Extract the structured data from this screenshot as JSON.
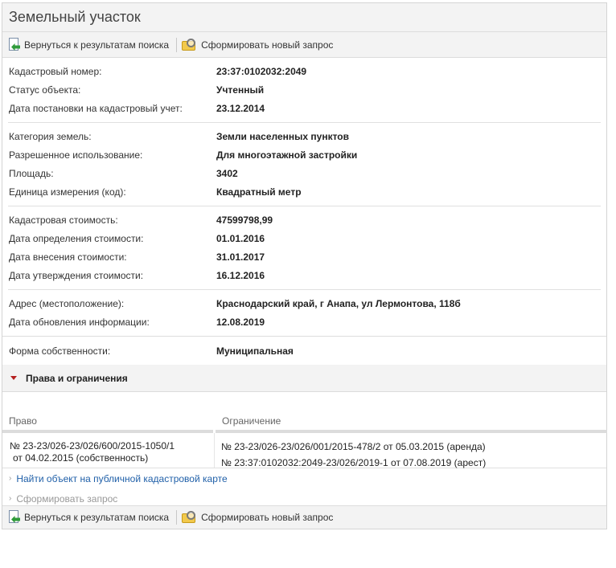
{
  "title": "Земельный участок",
  "toolbar": {
    "back_label": "Вернуться к результатам поиска",
    "new_query_label": "Сформировать новый запрос"
  },
  "groups": [
    [
      {
        "key": "Кадастровый номер:",
        "value": "23:37:0102032:2049"
      },
      {
        "key": "Статус объекта:",
        "value": "Учтенный"
      },
      {
        "key": "Дата постановки на кадастровый учет:",
        "value": "23.12.2014"
      }
    ],
    [
      {
        "key": "Категория земель:",
        "value": "Земли населенных пунктов"
      },
      {
        "key": "Разрешенное использование:",
        "value": "Для многоэтажной застройки"
      },
      {
        "key": "Площадь:",
        "value": "3402"
      },
      {
        "key": "Единица измерения (код):",
        "value": "Квадратный метр"
      }
    ],
    [
      {
        "key": "Кадастровая стоимость:",
        "value": "47599798,99"
      },
      {
        "key": "Дата определения стоимости:",
        "value": "01.01.2016"
      },
      {
        "key": "Дата внесения стоимости:",
        "value": "31.01.2017"
      },
      {
        "key": "Дата утверждения стоимости:",
        "value": "16.12.2016"
      }
    ],
    [
      {
        "key": "Адрес (местоположение):",
        "value": "Краснодарский край, г Анапа, ул Лермонтова, 118б"
      },
      {
        "key": "Дата обновления информации:",
        "value": "12.08.2019"
      }
    ],
    [
      {
        "key": "Форма собственности:",
        "value": "Муниципальная"
      }
    ]
  ],
  "rights_section": {
    "title": "Права и ограничения",
    "col_right": "Право",
    "col_restriction": "Ограничение",
    "right_line1": "№ 23-23/026-23/026/600/2015-1050/1",
    "right_line2": "от 04.02.2015  (собственность)",
    "restriction_line1": "№ 23-23/026-23/026/001/2015-478/2  от 05.03.2015  (аренда)",
    "restriction_line2": "№ 23:37:0102032:2049-23/026/2019-1  от 07.08.2019  (арест)"
  },
  "links": {
    "public_map": "Найти объект на публичной кадастровой карте",
    "make_request": "Сформировать запрос"
  }
}
